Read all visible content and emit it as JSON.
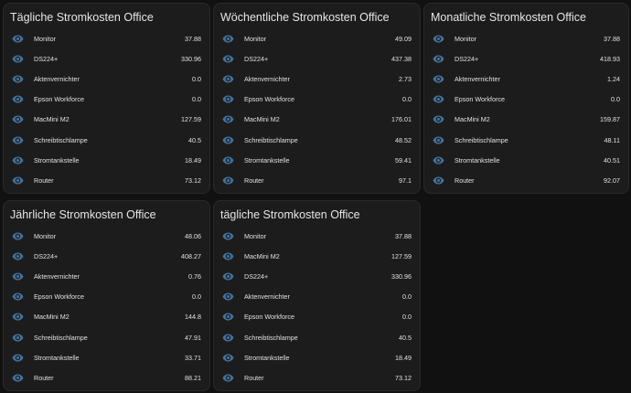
{
  "icon": "eye-icon",
  "icon_color": "#44739e",
  "cards": [
    {
      "title": "Tägliche Stromkosten Office",
      "rows": [
        {
          "name": "Monitor",
          "value": "37.88"
        },
        {
          "name": "DS224+",
          "value": "330.96"
        },
        {
          "name": "Aktenvernichter",
          "value": "0.0"
        },
        {
          "name": "Epson Workforce",
          "value": "0.0"
        },
        {
          "name": "MacMini M2",
          "value": "127.59"
        },
        {
          "name": "Schreibtischlampe",
          "value": "40.5"
        },
        {
          "name": "Stromtankstelle",
          "value": "18.49"
        },
        {
          "name": "Router",
          "value": "73.12"
        }
      ]
    },
    {
      "title": "Wöchentliche Stromkosten Office",
      "rows": [
        {
          "name": "Monitor",
          "value": "49.09"
        },
        {
          "name": "DS224+",
          "value": "437.38"
        },
        {
          "name": "Aktenvernichter",
          "value": "2.73"
        },
        {
          "name": "Epson Workforce",
          "value": "0.0"
        },
        {
          "name": "MacMini M2",
          "value": "176.01"
        },
        {
          "name": "Schreibtischlampe",
          "value": "48.52"
        },
        {
          "name": "Stromtankstelle",
          "value": "59.41"
        },
        {
          "name": "Router",
          "value": "97.1"
        }
      ]
    },
    {
      "title": "Monatliche Stromkosten Office",
      "rows": [
        {
          "name": "Monitor",
          "value": "37.88"
        },
        {
          "name": "DS224+",
          "value": "418.93"
        },
        {
          "name": "Aktenvernichter",
          "value": "1.24"
        },
        {
          "name": "Epson Workforce",
          "value": "0.0"
        },
        {
          "name": "MacMini M2",
          "value": "159.87"
        },
        {
          "name": "Schreibtischlampe",
          "value": "48.11"
        },
        {
          "name": "Stromtankstelle",
          "value": "40.51"
        },
        {
          "name": "Router",
          "value": "92.07"
        }
      ]
    },
    {
      "title": "Jährliche Stromkosten Office",
      "rows": [
        {
          "name": "Monitor",
          "value": "48.06"
        },
        {
          "name": "DS224+",
          "value": "408.27"
        },
        {
          "name": "Aktenvernichter",
          "value": "0.76"
        },
        {
          "name": "Epson Workforce",
          "value": "0.0"
        },
        {
          "name": "MacMini M2",
          "value": "144.8"
        },
        {
          "name": "Schreibtischlampe",
          "value": "47.91"
        },
        {
          "name": "Stromtankstelle",
          "value": "33.71"
        },
        {
          "name": "Router",
          "value": "88.21"
        }
      ]
    },
    {
      "title": "tägliche Stromkosten Office",
      "rows": [
        {
          "name": "Monitor",
          "value": "37.88"
        },
        {
          "name": "MacMini M2",
          "value": "127.59"
        },
        {
          "name": "DS224+",
          "value": "330.96"
        },
        {
          "name": "Aktenvernichter",
          "value": "0.0"
        },
        {
          "name": "Epson Workforce",
          "value": "0.0"
        },
        {
          "name": "Schreibtischlampe",
          "value": "40.5"
        },
        {
          "name": "Stromtankstelle",
          "value": "18.49"
        },
        {
          "name": "Router",
          "value": "73.12"
        }
      ]
    }
  ]
}
